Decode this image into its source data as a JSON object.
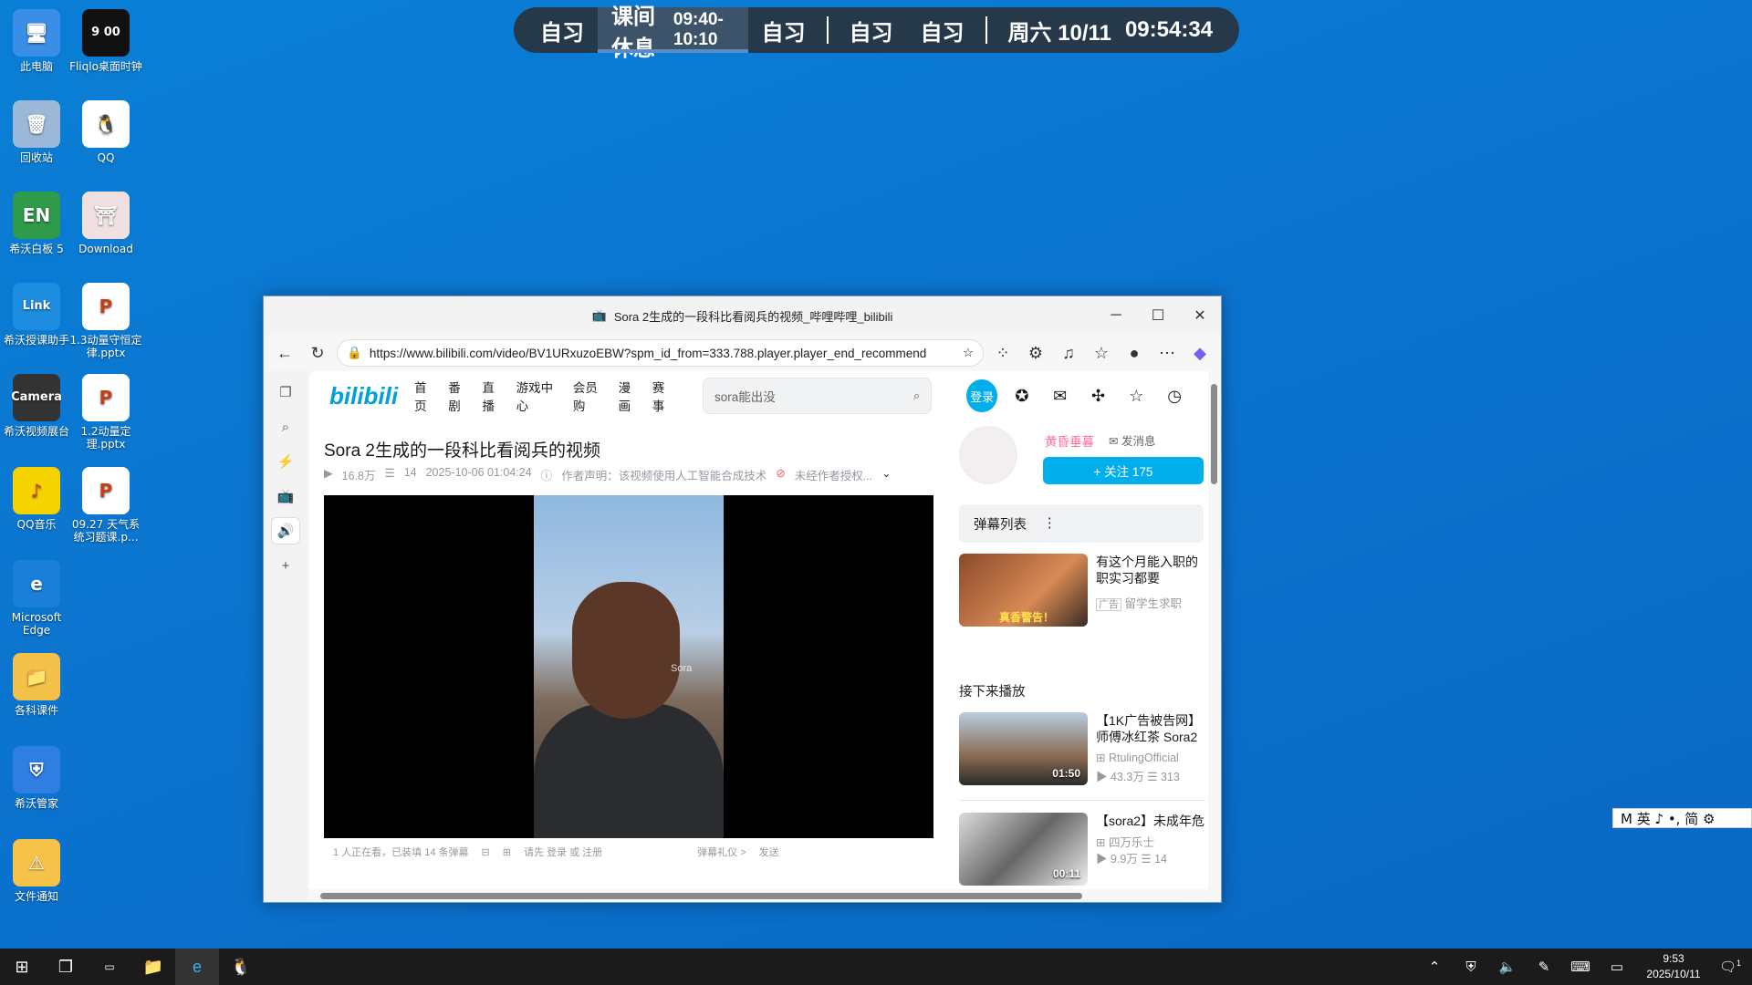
{
  "desktop_icons": [
    {
      "label": "此电脑",
      "glyph": "🖥"
    },
    {
      "label": "Fliqlo桌面时钟",
      "glyph": "9 00"
    },
    {
      "label": "回收站",
      "glyph": "🗑"
    },
    {
      "label": "QQ",
      "glyph": "🐧"
    },
    {
      "label": "希沃白板 5",
      "glyph": "EN"
    },
    {
      "label": "Download",
      "glyph": "⛩"
    },
    {
      "label": "希沃授课助手",
      "glyph": "Link"
    },
    {
      "label": "1.3动量守恒定律.pptx",
      "glyph": "P"
    },
    {
      "label": "希沃视频展台",
      "glyph": "Camera"
    },
    {
      "label": "1.2动量定理.pptx",
      "glyph": "P"
    },
    {
      "label": "QQ音乐",
      "glyph": "♪"
    },
    {
      "label": "09.27 天气系统习题课.p...",
      "glyph": "P"
    },
    {
      "label": "Microsoft Edge",
      "glyph": "e"
    },
    {
      "label": "各科课件",
      "glyph": "📁"
    },
    {
      "label": "希沃管家",
      "glyph": "⛨"
    },
    {
      "label": "文件通知",
      "glyph": "⚠"
    }
  ],
  "schedule": {
    "items": [
      "自习",
      "课间休息",
      "自习",
      "自习",
      "自习"
    ],
    "current_time_range": "09:40-10:10",
    "date": "周六 10/11",
    "clock": "09:54:34"
  },
  "browser": {
    "title": "Sora 2生成的一段科比看阅兵的视频_哔哩哔哩_bilibili",
    "url": "https://www.bilibili.com/video/BV1URxuzoEBW?spm_id_from=333.788.player.player_end_recommend",
    "nav": [
      "首页",
      "番剧",
      "直播",
      "游戏中心",
      "会员购",
      "漫画",
      "赛事"
    ],
    "logo": "bilibili",
    "search_placeholder": "sora能出没",
    "login": "登录",
    "video": {
      "title": "Sora 2生成的一段科比看阅兵的视频",
      "views": "16.8万",
      "danmaku": "14",
      "date": "2025-10-06 01:04:24",
      "statement": "作者声明：该视频使用人工智能合成技术",
      "unauthorized": "未经作者授权...",
      "watermark": "Sora",
      "controls": "1 人正在看，已装填 14 条弹幕",
      "controls_login": "请先 登录 或 注册",
      "controls_etiquette": "弹幕礼仪 >",
      "controls_send": "发送"
    },
    "uploader": {
      "name": "黄昏垂暮",
      "message": "发消息",
      "follow": "+ 关注 175"
    },
    "danmu_list": "弹幕列表",
    "ad": {
      "title": "有这个月能入职的职实习都要",
      "tag": "广告",
      "source": "留学生求职",
      "thumb_text": "真香警告！"
    },
    "next_label": "接下来播放",
    "recs": [
      {
        "title": "【1K广告被告网】师傅冰红茶 Sora2",
        "author": "RtulingOfficial",
        "views": "43.3万",
        "danmaku": "313",
        "duration": "01:50"
      },
      {
        "title": "【sora2】未成年危",
        "author": "四万乐士",
        "views": "9.9万",
        "danmaku": "14",
        "duration": "00:11"
      }
    ]
  },
  "ime": "M 英 ♪ •, 简 ⚙",
  "taskbar": {
    "time": "9:53",
    "date": "2025/10/11",
    "notif": "1"
  }
}
